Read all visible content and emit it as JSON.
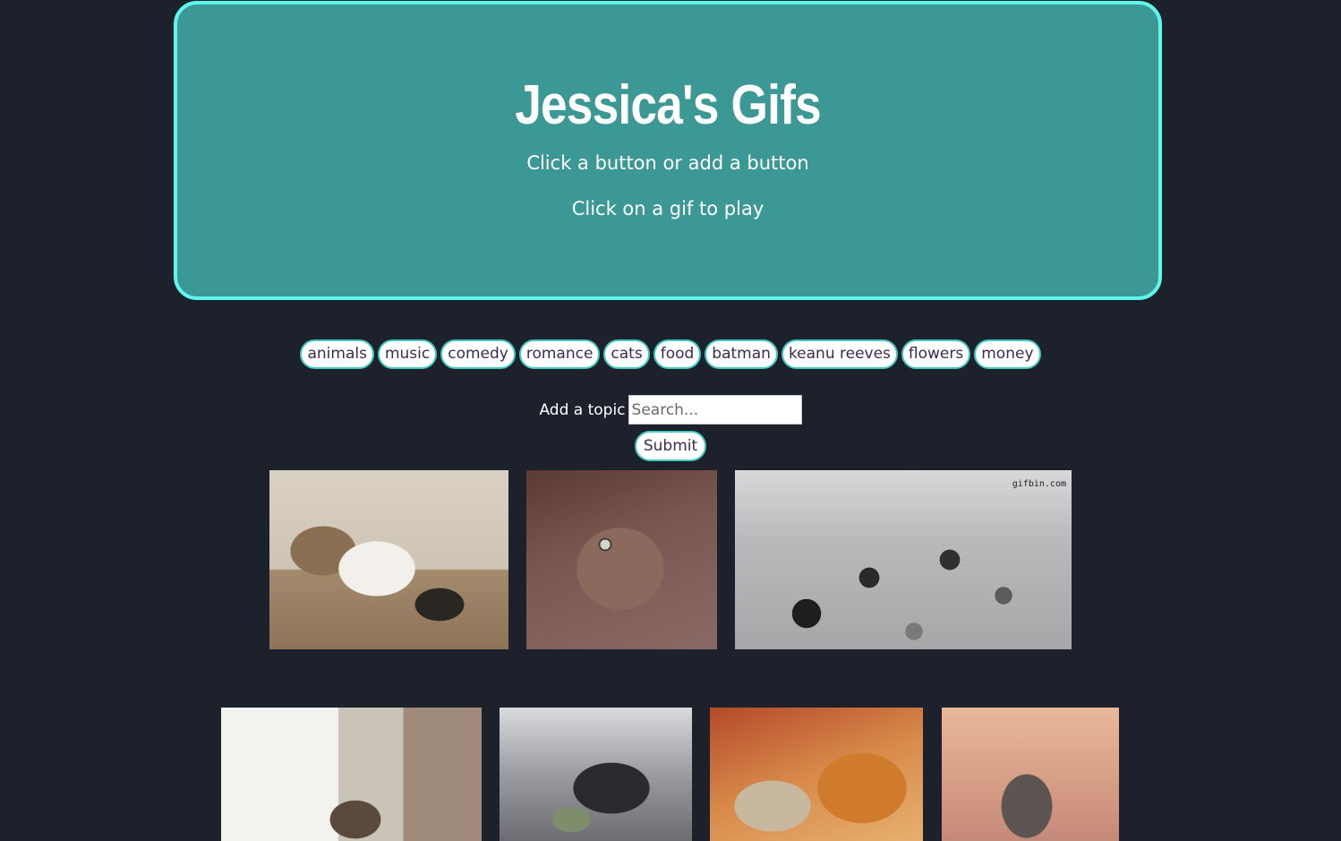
{
  "header": {
    "title": "Jessica's Gifs",
    "subtitle_1": "Click a button or add a button",
    "subtitle_2": "Click on a gif to play"
  },
  "topics": [
    "animals",
    "music",
    "comedy",
    "romance",
    "cats",
    "food",
    "batman",
    "keanu reeves",
    "flowers",
    "money"
  ],
  "add_topic": {
    "label": "Add a topic",
    "placeholder": "Search...",
    "value": "",
    "submit_label": "Submit"
  },
  "gifs": [
    {
      "subject": "two cats cuddling",
      "watermark": ""
    },
    {
      "subject": "tabby cat staring",
      "watermark": ""
    },
    {
      "subject": "group of cats on floor",
      "watermark": "gifbin.com"
    },
    {
      "subject": "cat at window",
      "watermark": ""
    },
    {
      "subject": "black cat with money",
      "watermark": ""
    },
    {
      "subject": "orange cats sleeping",
      "watermark": ""
    },
    {
      "subject": "kitten playing",
      "watermark": ""
    }
  ],
  "colors": {
    "page_background": "#1c212c",
    "jumbotron": "#3c9894",
    "jumbotron_border": "#5ef7ec",
    "button_border": "#42c9c0",
    "button_text": "#3d2a52"
  }
}
